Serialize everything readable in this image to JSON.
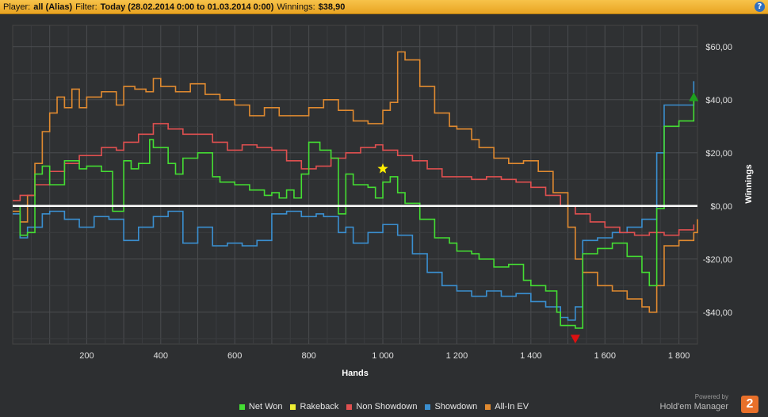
{
  "header": {
    "player_label": "Player:",
    "player_value": "all (Alias)",
    "filter_label": "Filter:",
    "filter_value": "Today (28.02.2014 0:00 to 01.03.2014 0:00)",
    "winnings_label": "Winnings:",
    "winnings_value": "$38,90",
    "help_icon": "question-icon"
  },
  "chart_data": {
    "type": "line",
    "xlabel": "Hands",
    "ylabel": "Winnings",
    "xlim": [
      0,
      1850
    ],
    "ylim": [
      -52,
      68
    ],
    "x_ticks": [
      200,
      400,
      600,
      800,
      1000,
      1200,
      1400,
      1600,
      1800
    ],
    "x_tick_labels": [
      "200",
      "400",
      "600",
      "800",
      "1 000",
      "1 200",
      "1 400",
      "1 600",
      "1 800"
    ],
    "y_ticks": [
      -40,
      -20,
      0,
      20,
      40,
      60
    ],
    "y_tick_labels": [
      "-$40,00",
      "-$20,00",
      "$0,00",
      "$20,00",
      "$40,00",
      "$60,00"
    ],
    "grid": true,
    "legend_position": "bottom",
    "series": [
      {
        "name": "Net Won",
        "color": "#44dd33",
        "x": [
          0,
          20,
          40,
          60,
          80,
          100,
          140,
          180,
          200,
          240,
          270,
          300,
          320,
          340,
          370,
          380,
          420,
          440,
          460,
          500,
          540,
          560,
          600,
          640,
          680,
          700,
          720,
          740,
          760,
          780,
          800,
          830,
          860,
          880,
          900,
          920,
          960,
          980,
          1000,
          1020,
          1040,
          1060,
          1100,
          1140,
          1180,
          1200,
          1240,
          1260,
          1300,
          1340,
          1380,
          1400,
          1440,
          1470,
          1480,
          1500,
          1520,
          1540,
          1580,
          1620,
          1660,
          1700,
          1720,
          1740,
          1760,
          1800,
          1840,
          1850
        ],
        "values": [
          0,
          -11,
          -10,
          12,
          15,
          8,
          17,
          14,
          15,
          13,
          -2,
          17,
          14,
          16,
          25,
          22,
          16,
          12,
          18,
          20,
          11,
          9,
          8,
          6,
          4,
          5,
          3,
          6,
          3,
          12,
          24,
          21,
          18,
          -3,
          12,
          8,
          7,
          3,
          9,
          11,
          5,
          1,
          -5,
          -12,
          -14,
          -17,
          -18,
          -20,
          -23,
          -22,
          -28,
          -30,
          -32,
          -40,
          -45,
          -45,
          -46,
          -18,
          -16,
          -14,
          -19,
          -25,
          -30,
          -1,
          30,
          32,
          40,
          40
        ]
      },
      {
        "name": "Rakeback",
        "color": "#eeee33",
        "x": [
          0,
          1850
        ],
        "values": [
          0,
          0
        ]
      },
      {
        "name": "Non Showdown",
        "color": "#e05050",
        "x": [
          0,
          20,
          60,
          100,
          140,
          180,
          240,
          280,
          300,
          340,
          380,
          420,
          460,
          500,
          540,
          580,
          620,
          660,
          700,
          740,
          780,
          820,
          860,
          900,
          940,
          980,
          1000,
          1040,
          1080,
          1120,
          1160,
          1200,
          1240,
          1280,
          1320,
          1360,
          1400,
          1440,
          1480,
          1520,
          1560,
          1600,
          1640,
          1680,
          1720,
          1760,
          1800,
          1840
        ],
        "values": [
          2,
          4,
          8,
          13,
          16,
          19,
          22,
          21,
          24,
          27,
          31,
          29,
          27,
          27,
          24,
          21,
          23,
          22,
          21,
          17,
          14,
          15,
          18,
          20,
          22,
          23,
          21,
          19,
          17,
          14,
          11,
          11,
          10,
          11,
          10,
          9,
          7,
          4,
          0,
          -3,
          -6,
          -8,
          -10,
          -11,
          -10,
          -11,
          -9,
          -7
        ]
      },
      {
        "name": "Showdown",
        "color": "#3a8fd0",
        "x": [
          0,
          20,
          40,
          80,
          100,
          140,
          180,
          220,
          260,
          300,
          340,
          380,
          420,
          460,
          500,
          540,
          580,
          620,
          660,
          700,
          740,
          780,
          820,
          840,
          880,
          900,
          920,
          960,
          1000,
          1040,
          1080,
          1120,
          1160,
          1200,
          1240,
          1280,
          1320,
          1360,
          1400,
          1440,
          1480,
          1500,
          1520,
          1540,
          1580,
          1620,
          1660,
          1700,
          1740,
          1760,
          1800,
          1840
        ],
        "values": [
          -3,
          -12,
          -8,
          -3,
          -2,
          -5,
          -8,
          -4,
          -5,
          -13,
          -8,
          -4,
          -2,
          -14,
          -8,
          -15,
          -14,
          -15,
          -13,
          -3,
          -2,
          -4,
          -3,
          -4,
          -10,
          -8,
          -14,
          -10,
          -7,
          -11,
          -18,
          -25,
          -30,
          -32,
          -34,
          -32,
          -34,
          -33,
          -36,
          -38,
          -42,
          -43,
          -38,
          -13,
          -12,
          -10,
          -8,
          -5,
          20,
          38,
          38,
          47
        ]
      },
      {
        "name": "All-In EV",
        "color": "#e08a30",
        "x": [
          0,
          20,
          40,
          60,
          80,
          100,
          120,
          140,
          160,
          180,
          200,
          240,
          280,
          300,
          330,
          360,
          380,
          400,
          440,
          480,
          520,
          560,
          600,
          640,
          680,
          720,
          760,
          800,
          840,
          880,
          920,
          960,
          1000,
          1020,
          1040,
          1060,
          1100,
          1140,
          1180,
          1200,
          1240,
          1260,
          1300,
          1340,
          1380,
          1420,
          1460,
          1500,
          1520,
          1540,
          1580,
          1620,
          1660,
          1700,
          1720,
          1740,
          1760,
          1800,
          1840,
          1850
        ],
        "values": [
          -2,
          -6,
          4,
          16,
          28,
          35,
          41,
          37,
          44,
          37,
          41,
          43,
          38,
          45,
          44,
          43,
          48,
          45,
          43,
          46,
          42,
          40,
          38,
          34,
          37,
          34,
          34,
          37,
          40,
          36,
          32,
          31,
          36,
          39,
          58,
          55,
          45,
          35,
          30,
          29,
          25,
          22,
          18,
          16,
          17,
          13,
          5,
          -8,
          -20,
          -25,
          -30,
          -32,
          -35,
          -38,
          -40,
          -30,
          -15,
          -13,
          -10,
          -5
        ]
      }
    ],
    "markers": [
      {
        "type": "star",
        "x": 1000,
        "y": 14,
        "color": "#ffee00"
      },
      {
        "type": "triangle-up",
        "x": 1840,
        "y": 41,
        "color": "#1ea01e"
      },
      {
        "type": "triangle-down",
        "x": 1520,
        "y": -50,
        "color": "#dd1111"
      }
    ]
  },
  "legend": {
    "items": [
      {
        "label": "Net Won",
        "color": "#44dd33"
      },
      {
        "label": "Rakeback",
        "color": "#eeee33"
      },
      {
        "label": "Non Showdown",
        "color": "#e05050"
      },
      {
        "label": "Showdown",
        "color": "#3a8fd0"
      },
      {
        "label": "All-In EV",
        "color": "#e08a30"
      }
    ]
  },
  "branding": {
    "powered_by": "Powered by",
    "name": "Hold'em Manager",
    "logo_text": "2"
  }
}
